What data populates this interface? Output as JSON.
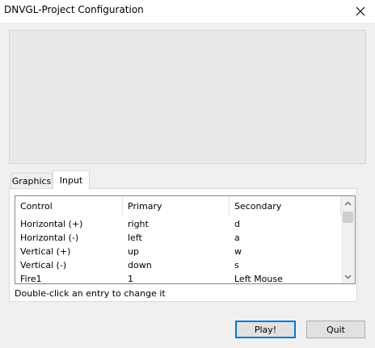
{
  "window": {
    "title": "DNVGL-Project Configuration",
    "close_icon": "close-icon"
  },
  "tabs": [
    {
      "label": "Graphics",
      "selected": false
    },
    {
      "label": "Input",
      "selected": true
    }
  ],
  "input_table": {
    "columns": [
      "Control",
      "Primary",
      "Secondary"
    ],
    "rows": [
      [
        "Horizontal (+)",
        "right",
        "d"
      ],
      [
        "Horizontal (-)",
        "left",
        "a"
      ],
      [
        "Vertical (+)",
        "up",
        "w"
      ],
      [
        "Vertical (-)",
        "down",
        "s"
      ],
      [
        "Fire1",
        "1",
        "Left Mouse"
      ]
    ]
  },
  "hint": "Double-click an entry to change it",
  "buttons": {
    "play": "Play!",
    "quit": "Quit"
  },
  "colors": {
    "focus_border": "#0078d7",
    "button_bg": "#e1e1e1",
    "window_bg": "#f0f0f0"
  }
}
